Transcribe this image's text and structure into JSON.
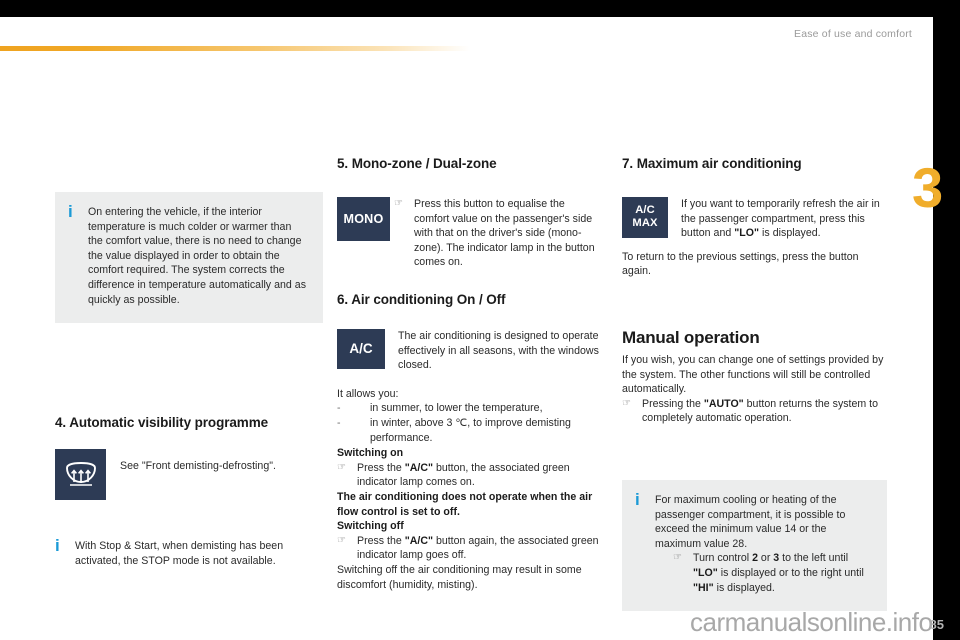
{
  "header": {
    "running_title": "Ease of use and comfort",
    "chapter_number": "3"
  },
  "footer": {
    "watermark": "carmanualsonline.info",
    "page_number": "85"
  },
  "colors": {
    "accent_orange": "#f0ad2b",
    "info_blue": "#1b9ad6",
    "button_navy": "#2d3b55",
    "infobox_grey": "#eceded"
  },
  "column_1": {
    "info_note_top": "On entering the vehicle, if the interior temperature is much colder or warmer than the comfort value, there is no need to change the value displayed in order to obtain the comfort required. The system corrects the difference in temperature automatically and as quickly as possible.",
    "section_4": {
      "heading": "4. Automatic visibility programme",
      "button_icon": "windscreen-demist-icon",
      "text": "See \"Front demisting-defrosting\"."
    },
    "info_note_bottom": "With Stop & Start, when demisting has been activated, the STOP mode is not available."
  },
  "column_2": {
    "section_5": {
      "heading": "5. Mono-zone / Dual-zone",
      "button_label": "MONO",
      "bullet_icon": "pointing-hand-icon",
      "text": "Press this button to equalise the comfort value on the passenger's side with that on the driver's side (mono-zone). The indicator lamp in the button comes on."
    },
    "section_6": {
      "heading": "6. Air conditioning On / Off",
      "button_label": "A/C",
      "intro": "The air conditioning is designed to operate effectively in all seasons, with the windows closed.",
      "allows_label": "It allows you:",
      "allows_items": [
        "in summer, to lower the temperature,",
        "in winter, above 3 ℃, to improve demisting performance."
      ],
      "switch_on_label": "Switching on",
      "switch_on_text_pre": "Press the ",
      "switch_on_text_button": "\"A/C\"",
      "switch_on_text_post": " button, the associated green indicator lamp comes on.",
      "warning": "The air conditioning does not operate when the air flow control is set to off.",
      "switch_off_label": "Switching off",
      "switch_off_text_pre": "Press the ",
      "switch_off_text_button": "\"A/C\"",
      "switch_off_text_post": " button again, the associated green indicator lamp goes off.",
      "closing": "Switching off the air conditioning may result in some discomfort (humidity, misting)."
    }
  },
  "column_3": {
    "section_7": {
      "heading": "7. Maximum air conditioning",
      "button_label_line1": "A/C",
      "button_label_line2": "MAX",
      "text_pre": "If you want to temporarily refresh the air in the passenger compartment, press this button and  ",
      "text_button": "\"LO\"",
      "text_post": " is displayed.",
      "return_text": "To return to the previous settings, press the button again."
    },
    "manual_operation": {
      "heading": "Manual operation",
      "intro": "If you wish, you can change one of settings provided by the system. The other functions will still be controlled automatically.",
      "bullet_pre": "Pressing the ",
      "bullet_button": "\"AUTO\"",
      "bullet_post": " button returns the system to completely automatic operation."
    },
    "info_note": {
      "text_part1": "For maximum cooling or heating of the passenger compartment, it is possible to exceed the minimum value 14 or the maximum value 28.",
      "bullet_part1": "Turn control ",
      "bullet_control_a": "2",
      "bullet_or": " or ",
      "bullet_control_b": "3",
      "bullet_part2": " to the left until ",
      "bullet_lo": "\"LO\"",
      "bullet_part3": " is displayed or to the right until ",
      "bullet_hi": "\"HI\"",
      "bullet_part4": " is displayed."
    }
  }
}
